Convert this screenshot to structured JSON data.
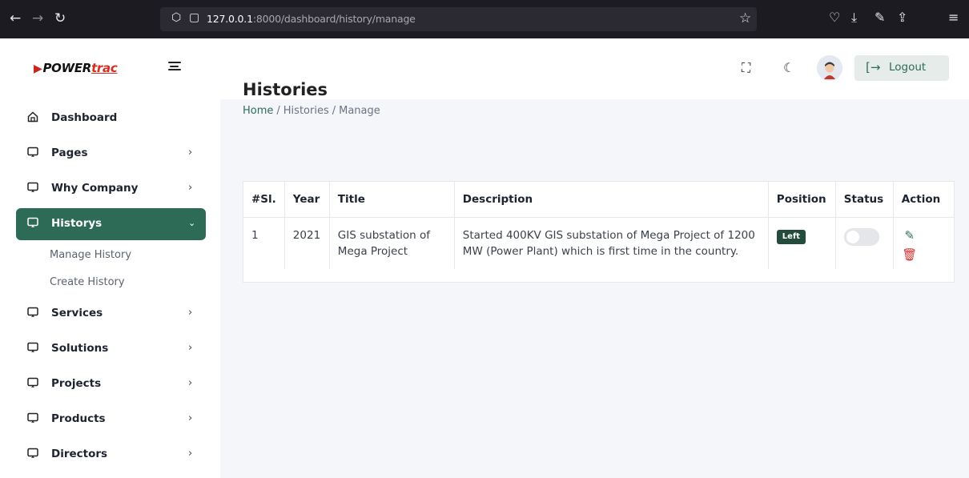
{
  "browser": {
    "url_host": "127.0.0.1",
    "url_rest": ":8000/dashboard/history/manage"
  },
  "brand": {
    "name_main": "POWER",
    "name_accent": "trac"
  },
  "sidebar": {
    "items": [
      {
        "label": "Dashboard",
        "icon": "home-icon",
        "has_arrow": false
      },
      {
        "label": "Pages",
        "icon": "monitor-icon",
        "has_arrow": true
      },
      {
        "label": "Why Company",
        "icon": "monitor-icon",
        "has_arrow": true
      },
      {
        "label": "Historys",
        "icon": "monitor-icon",
        "has_arrow": true,
        "active": true
      },
      {
        "label": "Services",
        "icon": "monitor-icon",
        "has_arrow": true
      },
      {
        "label": "Solutions",
        "icon": "monitor-icon",
        "has_arrow": true
      },
      {
        "label": "Projects",
        "icon": "monitor-icon",
        "has_arrow": true
      },
      {
        "label": "Products",
        "icon": "monitor-icon",
        "has_arrow": true
      },
      {
        "label": "Directors",
        "icon": "monitor-icon",
        "has_arrow": true
      }
    ],
    "sub_items": [
      "Manage History",
      "Create History"
    ]
  },
  "topbar": {
    "logout_label": "Logout"
  },
  "page": {
    "title": "Histories",
    "breadcrumb": [
      "Home",
      "Histories",
      "Manage"
    ]
  },
  "table": {
    "headers": [
      "#Sl.",
      "Year",
      "Title",
      "Description",
      "Position",
      "Status",
      "Action"
    ],
    "rows": [
      {
        "sl": "1",
        "year": "2021",
        "title": "GIS substation of Mega Project",
        "description": "Started 400KV GIS substation of Mega Project of 1200 MW (Power Plant) which is first time in the country.",
        "position": "Left",
        "status_on": false
      }
    ]
  },
  "colors": {
    "accent": "#2e6b57",
    "danger": "#d32f2f",
    "badge": "#234c3c"
  }
}
